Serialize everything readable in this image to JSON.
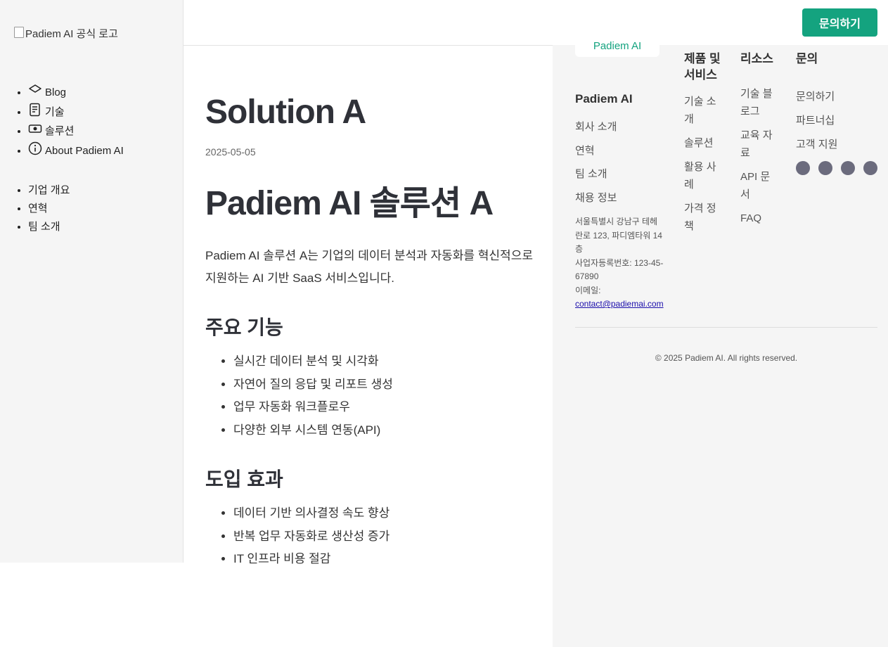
{
  "logo": {
    "alt_text": "Padiem AI 공식 로고"
  },
  "header": {
    "cta_label": "문의하기"
  },
  "sidebar": {
    "nav_primary": [
      {
        "icon": "diamond-icon",
        "label": "Blog"
      },
      {
        "icon": "document-icon",
        "label": "기술"
      },
      {
        "icon": "box-icon",
        "label": "솔루션"
      },
      {
        "icon": "info-icon",
        "label": "About Padiem AI"
      }
    ],
    "nav_secondary": [
      "기업 개요",
      "연혁",
      "팀 소개"
    ]
  },
  "main": {
    "title": "Solution A",
    "date": "2025-05-05",
    "heading": "Padiem AI 솔루션 A",
    "intro": "Padiem AI 솔루션 A는 기업의 데이터 분석과 자동화를 혁신적으로 지원하는 AI 기반 SaaS 서비스입니다.",
    "features_heading": "주요 기능",
    "features": [
      "실시간 데이터 분석 및 시각화",
      "자연어 질의 응답 및 리포트 생성",
      "업무 자동화 워크플로우",
      "다양한 외부 시스템 연동(API)"
    ],
    "effects_heading": "도입 효과",
    "effects": [
      "데이터 기반 의사결정 속도 향상",
      "반복 업무 자동화로 생산성 증가",
      "IT 인프라 비용 절감"
    ]
  },
  "footer": {
    "brand_label": "Padiem AI",
    "company": {
      "heading": "Padiem AI",
      "links": [
        "회사 소개",
        "연혁",
        "팀 소개",
        "채용 정보"
      ],
      "address": "서울특별시 강남구 테헤란로 123, 파디엠타워 14층",
      "biz_no": "사업자등록번호: 123-45-67890",
      "email_label": "이메일:",
      "email": "contact@padiemai.com"
    },
    "products": {
      "heading": "제품 및 서비스",
      "links": [
        "기술 소개",
        "솔루션",
        "활용 사례",
        "가격 정책"
      ]
    },
    "resources": {
      "heading": "리소스",
      "links": [
        "기술 블로그",
        "교육 자료",
        "API 문서",
        "FAQ"
      ]
    },
    "contact": {
      "heading": "문의",
      "links": [
        "문의하기",
        "파트너십",
        "고객 지원"
      ]
    },
    "social_icons": [
      "social-icon-1",
      "social-icon-2",
      "social-icon-3",
      "social-icon-4"
    ],
    "copyright": "© 2025 Padiem AI. All rights reserved."
  },
  "colors": {
    "accent": "#14a37f",
    "sidebar_bg": "#f5f5f5",
    "text": "#2f3138",
    "social_dot": "#6b6b7d"
  }
}
